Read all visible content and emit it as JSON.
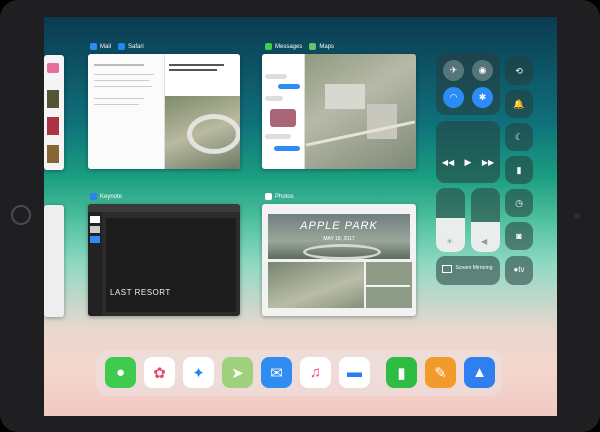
{
  "switcher": {
    "mail_label": "Mail",
    "safari_label": "Safari",
    "messages_label": "Messages",
    "maps_label": "Maps",
    "keynote_label": "Keynote",
    "photos_label": "Photos",
    "keynote_slide_text": "LAST RESORT",
    "photos_title": "APPLE PARK",
    "photos_subtitle": "MAY 18, 2017"
  },
  "control_center": {
    "screen_mirroring_label": "Screen Mirroring",
    "apple_tv_label": "tv",
    "colors": {
      "active_blue": "#2b8cf5",
      "active_orange": "#f39a2d"
    }
  },
  "dock": {
    "apps": [
      {
        "name": "messages-app-icon",
        "glyph": "💬",
        "color": "#3ecb4e"
      },
      {
        "name": "photos-app-icon",
        "glyph": "✿",
        "color": "#ffffff"
      },
      {
        "name": "safari-app-icon",
        "glyph": "🧭",
        "color": "#1e88f5"
      },
      {
        "name": "maps-app-icon",
        "glyph": "➤",
        "color": "#66c26b"
      },
      {
        "name": "mail-app-icon",
        "glyph": "✉",
        "color": "#2f8cf0"
      },
      {
        "name": "music-app-icon",
        "glyph": "♫",
        "color": "#ffffff"
      },
      {
        "name": "files-app-icon",
        "glyph": "▬",
        "color": "#2a7ff0"
      },
      {
        "name": "numbers-app-icon",
        "glyph": "▮",
        "color": "#2fbc45"
      },
      {
        "name": "pages-app-icon",
        "glyph": "✎",
        "color": "#f39a2d"
      },
      {
        "name": "keynote-app-icon",
        "glyph": "▲",
        "color": "#2f7ff0"
      }
    ]
  }
}
